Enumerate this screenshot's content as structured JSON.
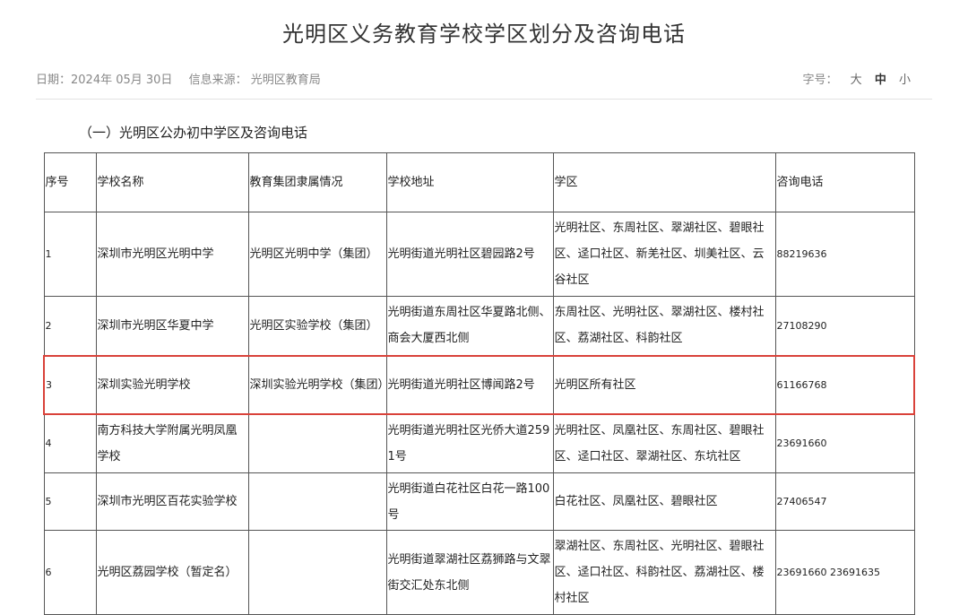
{
  "page": {
    "title": "光明区义务教育学校学区划分及咨询电话",
    "date_label": "日期：2024年 05月 30日",
    "source_label": "信息来源： 光明区教育局",
    "font_size_label": "字号：",
    "font_sizes": [
      "大",
      "中",
      "小"
    ],
    "active_font_size": "中",
    "section_title": "（一）光明区公办初中学区及咨询电话"
  },
  "table": {
    "headers": [
      "序号",
      "学校名称",
      "教育集团隶属情况",
      "学校地址",
      "学区",
      "咨询电话"
    ],
    "rows": [
      {
        "no": "1",
        "school": "深圳市光明区光明中学",
        "group": "光明区光明中学（集团）",
        "address": "光明街道光明社区碧园路2号",
        "district": "光明社区、东周社区、翠湖社区、碧眼社区、迳口社区、新羌社区、圳美社区、云谷社区",
        "phone": "88219636"
      },
      {
        "no": "2",
        "school": "深圳市光明区华夏中学",
        "group": "光明区实验学校（集团）",
        "address": "光明街道东周社区华夏路北侧、商会大厦西北侧",
        "district": "东周社区、光明社区、翠湖社区、楼村社区、荔湖社区、科韵社区",
        "phone": "27108290"
      },
      {
        "no": "3",
        "school": "深圳实验光明学校",
        "group": "深圳实验光明学校（集团）",
        "address": "光明街道光明社区博闻路2号",
        "district": "光明区所有社区",
        "phone": "61166768"
      },
      {
        "no": "4",
        "school": "南方科技大学附属光明凤凰学校",
        "group": "",
        "address": "光明街道光明社区光侨大道2591号",
        "district": "光明社区、凤凰社区、东周社区、碧眼社区、迳口社区、翠湖社区、东坑社区",
        "phone": "23691660"
      },
      {
        "no": "5",
        "school": "深圳市光明区百花实验学校",
        "group": "",
        "address": "光明街道白花社区白花一路100号",
        "district": "白花社区、凤凰社区、碧眼社区",
        "phone": "27406547"
      },
      {
        "no": "6",
        "school": "光明区荔园学校（暂定名）",
        "group": "",
        "address": "光明街道翠湖社区荔狮路与文翠街交汇处东北侧",
        "district": "翠湖社区、东周社区、光明社区、碧眼社区、迳口社区、科韵社区、荔湖社区、楼村社区",
        "phone": "23691660 23691635"
      }
    ]
  }
}
